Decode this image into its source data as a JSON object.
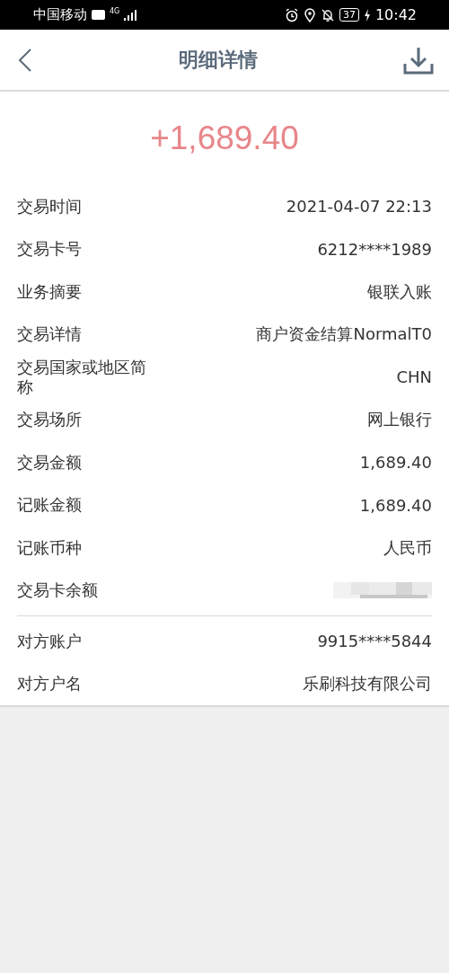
{
  "status_bar": {
    "carrier": "中国移动",
    "network": "4G",
    "battery": "37",
    "time": "10:42"
  },
  "header": {
    "title": "明细详情"
  },
  "amount": "+1,689.40",
  "sections": [
    {
      "rows": [
        {
          "kind": "text",
          "label": "交易时间",
          "value": "2021-04-07 22:13"
        },
        {
          "kind": "text",
          "label": "交易卡号",
          "value": "6212****1989"
        },
        {
          "kind": "text",
          "label": "业务摘要",
          "value": "银联入账"
        },
        {
          "kind": "text",
          "label": "交易详情",
          "value": "商户资金结算NormalT0"
        },
        {
          "kind": "text",
          "label": "交易国家或地区简称",
          "value": "CHN"
        },
        {
          "kind": "text",
          "label": "交易场所",
          "value": "网上银行"
        },
        {
          "kind": "text",
          "label": "交易金额",
          "value": "1,689.40"
        },
        {
          "kind": "text",
          "label": "记账金额",
          "value": "1,689.40"
        },
        {
          "kind": "text",
          "label": "记账币种",
          "value": "人民币"
        },
        {
          "kind": "masked",
          "label": "交易卡余额"
        }
      ]
    },
    {
      "rows": [
        {
          "kind": "text",
          "label": "对方账户",
          "value": "9915****5844"
        },
        {
          "kind": "text",
          "label": "对方户名",
          "value": "乐刷科技有限公司"
        }
      ]
    }
  ]
}
